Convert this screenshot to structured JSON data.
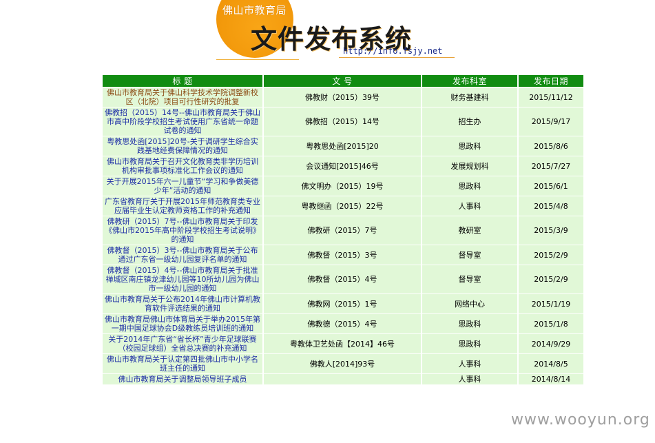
{
  "header": {
    "bureau": "佛山市教育局",
    "title": "文件发布系统",
    "url": "http://info.fsjy.net"
  },
  "table": {
    "columns": [
      "标 题",
      "文 号",
      "发布科室",
      "发布日期"
    ],
    "rows": [
      {
        "title": "佛山市教育局关于佛山科学技术学院调整新校区（北院）项目可行性研究的批复",
        "doc_no": "佛教财（2015）39号",
        "dept": "财务基建科",
        "date": "2015/11/12"
      },
      {
        "title": "佛教招（2015）14号--佛山市教育局关于佛山市高中阶段学校招生考试使用广东省统一命题试卷的通知",
        "doc_no": "佛教招（2015）14号",
        "dept": "招生办",
        "date": "2015/9/17"
      },
      {
        "title": "粤教思处函[2015]20号-关于调研学生综合实践基地经费保障情况的通知",
        "doc_no": "粤教思处函[2015]20",
        "dept": "思政科",
        "date": "2015/8/6"
      },
      {
        "title": "佛山市教育局关于召开文化教育类非学历培训机构审批事项标准化工作会议的通知",
        "doc_no": "会议通知[2015]46号",
        "dept": "发展规划科",
        "date": "2015/7/27"
      },
      {
        "title": "关于开展2015年六一儿童节“学习和争做美德少年”活动的通知",
        "doc_no": "佛文明办（2015）19号",
        "dept": "思政科",
        "date": "2015/6/1"
      },
      {
        "title": "广东省教育厅关于开展2015年师范教育类专业应届毕业生认定教师资格工作的补充通知",
        "doc_no": "粤教继函（2015）22号",
        "dept": "人事科",
        "date": "2015/4/8"
      },
      {
        "title": "佛教研（2015）7号--佛山市教育局关于印发《佛山市2015年高中阶段学校招生考试说明》的通知",
        "doc_no": "佛教研（2015）7号",
        "dept": "教研室",
        "date": "2015/3/9"
      },
      {
        "title": "佛教督（2015）3号--佛山市教育局关于公布通过广东省一级幼儿园复评名单的通知",
        "doc_no": "佛教督（2015）3号",
        "dept": "督导室",
        "date": "2015/2/9"
      },
      {
        "title": "佛教督（2015）4号--佛山市教育局关于批准禅城区南庄镇龙津幼儿园等10所幼儿园为佛山市一级幼儿园的通知",
        "doc_no": "佛教督（2015）4号",
        "dept": "督导室",
        "date": "2015/2/9"
      },
      {
        "title": "佛山市教育局关于公布2014年佛山市计算机教育软件评选结果的通知",
        "doc_no": "佛教网（2015）1号",
        "dept": "网络中心",
        "date": "2015/1/19"
      },
      {
        "title": "佛山市教育局佛山市体育局关于举办2015年第一期中国足球协会D级教练员培训班的通知",
        "doc_no": "佛教德（2015）4号",
        "dept": "思政科",
        "date": "2015/1/8"
      },
      {
        "title": "关于2014年广东省“省长杯”青少年足球联赛（校园足球组）全省总决赛的补充通知",
        "doc_no": "粤教体卫艺处函【2014】46号",
        "dept": "思政科",
        "date": "2014/9/29"
      },
      {
        "title": "佛山市教育局关于认定第四批佛山市中小学名班主任的通知",
        "doc_no": "佛教人[2014]93号",
        "dept": "人事科",
        "date": "2014/8/5"
      },
      {
        "title": "佛山市教育局关于调整局领导班子成员",
        "doc_no": "",
        "dept": "人事科",
        "date": "2014/8/14"
      }
    ]
  },
  "watermark": "www.wooyun.org"
}
